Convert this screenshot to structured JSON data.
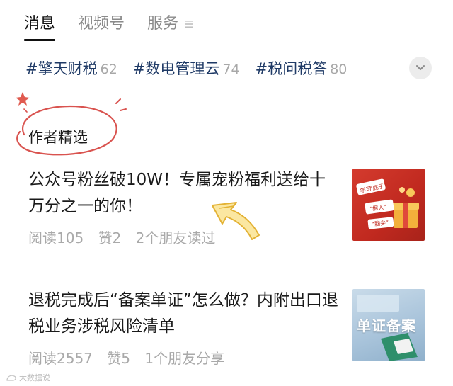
{
  "tabs": [
    {
      "label": "消息",
      "active": true
    },
    {
      "label": "视频号",
      "active": false
    },
    {
      "label": "服务",
      "active": false
    }
  ],
  "tab_menu_icon": "menu-lines-icon",
  "hashtags": [
    {
      "name": "#擎天财税",
      "count": "62"
    },
    {
      "name": "#数电管理云",
      "count": "74"
    },
    {
      "name": "#税问税答",
      "count": "80"
    }
  ],
  "expand_icon": "chevron-down-icon",
  "section": {
    "title": "作者精选"
  },
  "articles": [
    {
      "headline": "公众号粉丝破10W！专属宠粉福利送给十万分之一的你！",
      "reads": "阅读105",
      "likes": "赞2",
      "friends": "2个朋友读过",
      "thumb_lines": [
        "学习",
        "“底子”",
        "“掘人”",
        "“脑尖”"
      ]
    },
    {
      "headline": "退税完成后“备案单证”怎么做？内附出口退税业务涉税风险清单",
      "reads": "阅读2557",
      "likes": "赞5",
      "friends": "1个朋友分享",
      "thumb_label": "单证备案"
    }
  ],
  "watermark": "大数据说",
  "colors": {
    "tag": "#1f3a66",
    "accent_red": "#d9534f",
    "arrow": "#f2c84b"
  }
}
